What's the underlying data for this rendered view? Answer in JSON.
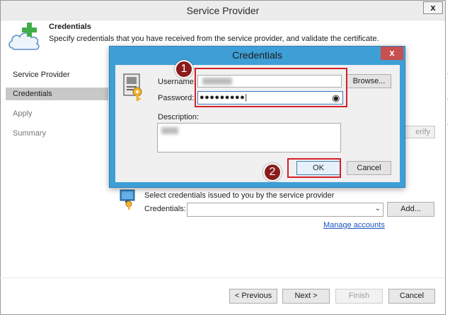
{
  "window": {
    "title": "Service Provider",
    "close_label": "x"
  },
  "header": {
    "title": "Credentials",
    "description": "Specify credentials that you have received from the service provider, and validate the certificate."
  },
  "nav": {
    "items": [
      {
        "label": "Service Provider"
      },
      {
        "label": "Credentials"
      },
      {
        "label": "Apply"
      },
      {
        "label": "Summary"
      }
    ]
  },
  "verify_button": "erify",
  "credentials_section": {
    "hint": "Select credentials issued to you by the service provider",
    "label": "Credentials:",
    "add_label": "Add...",
    "manage_label": "Manage accounts"
  },
  "footer": {
    "previous": "< Previous",
    "next": "Next >",
    "finish": "Finish",
    "cancel": "Cancel"
  },
  "dialog": {
    "title": "Credentials",
    "close_label": "x",
    "username_label": "Username:",
    "password_label": "Password:",
    "password_mask": "●●●●●●●●●|",
    "eye_glyph": "◉",
    "description_label": "Description:",
    "browse_label": "Browse...",
    "ok_label": "OK",
    "cancel_label": "Cancel"
  },
  "annotations": {
    "marker_1": "1",
    "marker_2": "2",
    "highlight_color": "#d42027"
  },
  "colors": {
    "dialog_frame": "#3e9fd6",
    "close_red": "#c75050",
    "link": "#1a55c0"
  }
}
